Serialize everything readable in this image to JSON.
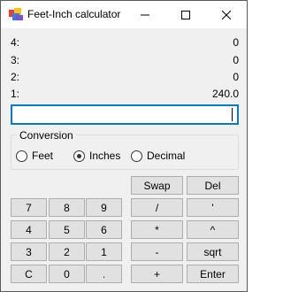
{
  "window": {
    "title": "Feet-Inch calculator"
  },
  "stack": [
    {
      "label": "4:",
      "value": "0"
    },
    {
      "label": "3:",
      "value": "0"
    },
    {
      "label": "2:",
      "value": "0"
    },
    {
      "label": "1:",
      "value": "240.0"
    }
  ],
  "entry": {
    "value": ""
  },
  "conversion": {
    "title": "Conversion",
    "options": [
      "Feet",
      "Inches",
      "Decimal"
    ],
    "selected": "Inches"
  },
  "ops_top": {
    "swap": "Swap",
    "del": "Del"
  },
  "keypad": {
    "r1": [
      "7",
      "8",
      "9"
    ],
    "r2": [
      "4",
      "5",
      "6"
    ],
    "r3": [
      "3",
      "2",
      "1"
    ],
    "r4": [
      "C",
      "0",
      "."
    ]
  },
  "ops": {
    "r1": [
      "/",
      "'"
    ],
    "r2": [
      "*",
      "^"
    ],
    "r3": [
      "-",
      "sqrt"
    ],
    "r4": [
      "+",
      "Enter"
    ]
  }
}
